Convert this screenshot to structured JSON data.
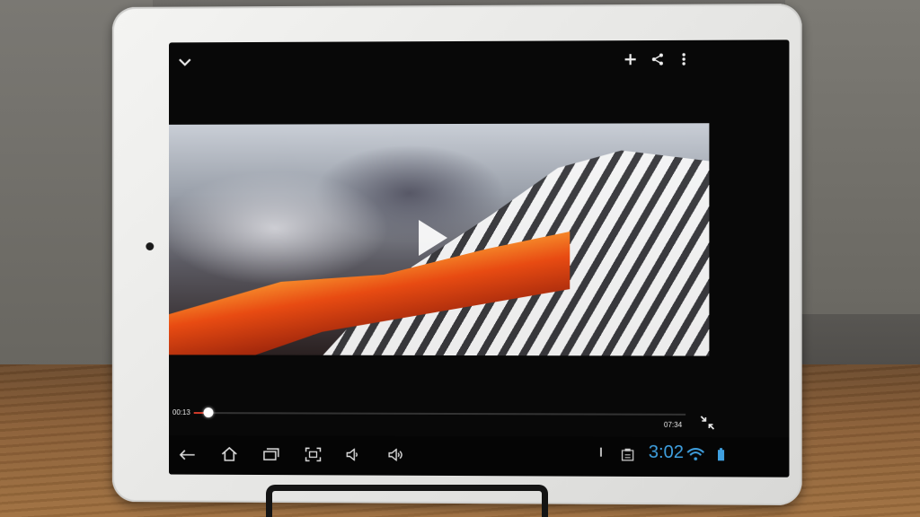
{
  "player": {
    "current_time": "00:13",
    "duration": "07:34",
    "progress_fraction": 0.029
  },
  "status_bar": {
    "clock": "3:02"
  },
  "colors": {
    "accent": "#3fa0e0",
    "progress": "#d23b2a"
  },
  "icons": {
    "top_left": "chevron-down-icon",
    "top_right": [
      "add-icon",
      "share-icon",
      "more-vert-icon"
    ],
    "fullscreen": "exit-fullscreen-icon",
    "nav": [
      "back-icon",
      "home-icon",
      "recent-apps-icon",
      "screenshot-icon",
      "volume-down-icon",
      "volume-up-icon"
    ],
    "status": [
      "notification-icon",
      "clipboard-icon",
      "wifi-icon",
      "battery-icon"
    ]
  }
}
